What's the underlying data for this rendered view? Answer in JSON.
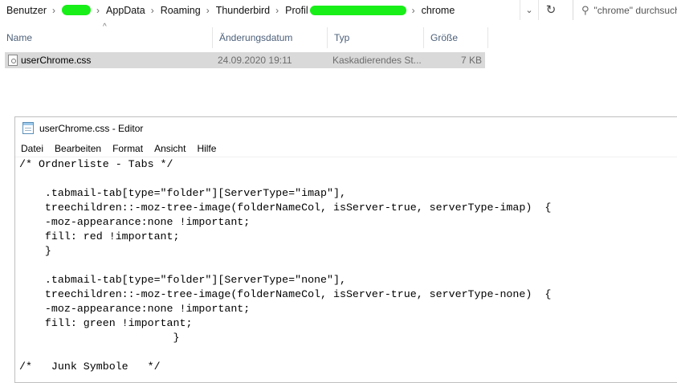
{
  "explorer": {
    "breadcrumb": [
      "Benutzer",
      "AppData",
      "Roaming",
      "Thunderbird",
      "Profil",
      "chrome"
    ],
    "search_placeholder": "\"chrome\" durchsuchen",
    "columns": [
      "Name",
      "Änderungsdatum",
      "Typ",
      "Größe"
    ],
    "files": [
      {
        "name": "userChrome.css",
        "modified": "24.09.2020 19:11",
        "type": "Kaskadierendes St...",
        "size": "7 KB"
      }
    ],
    "colors": {
      "selection": "#d9d9d9",
      "redaction": "#18ee18",
      "header_text": "#4c607a"
    }
  },
  "editor": {
    "window_title": "userChrome.css - Editor",
    "menu": [
      "Datei",
      "Bearbeiten",
      "Format",
      "Ansicht",
      "Hilfe"
    ],
    "lines": [
      "/* Ordnerliste - Tabs */",
      "",
      "    .tabmail-tab[type=\"folder\"][ServerType=\"imap\"],",
      "    treechildren::-moz-tree-image(folderNameCol, isServer-true, serverType-imap)  {",
      "    -moz-appearance:none !important;",
      "    fill: red !important;",
      "    }",
      "",
      "    .tabmail-tab[type=\"folder\"][ServerType=\"none\"],",
      "    treechildren::-moz-tree-image(folderNameCol, isServer-true, serverType-none)  {",
      "    -moz-appearance:none !important;",
      "    fill: green !important;",
      "                        }",
      "",
      "/*   Junk Symbole   */"
    ]
  }
}
